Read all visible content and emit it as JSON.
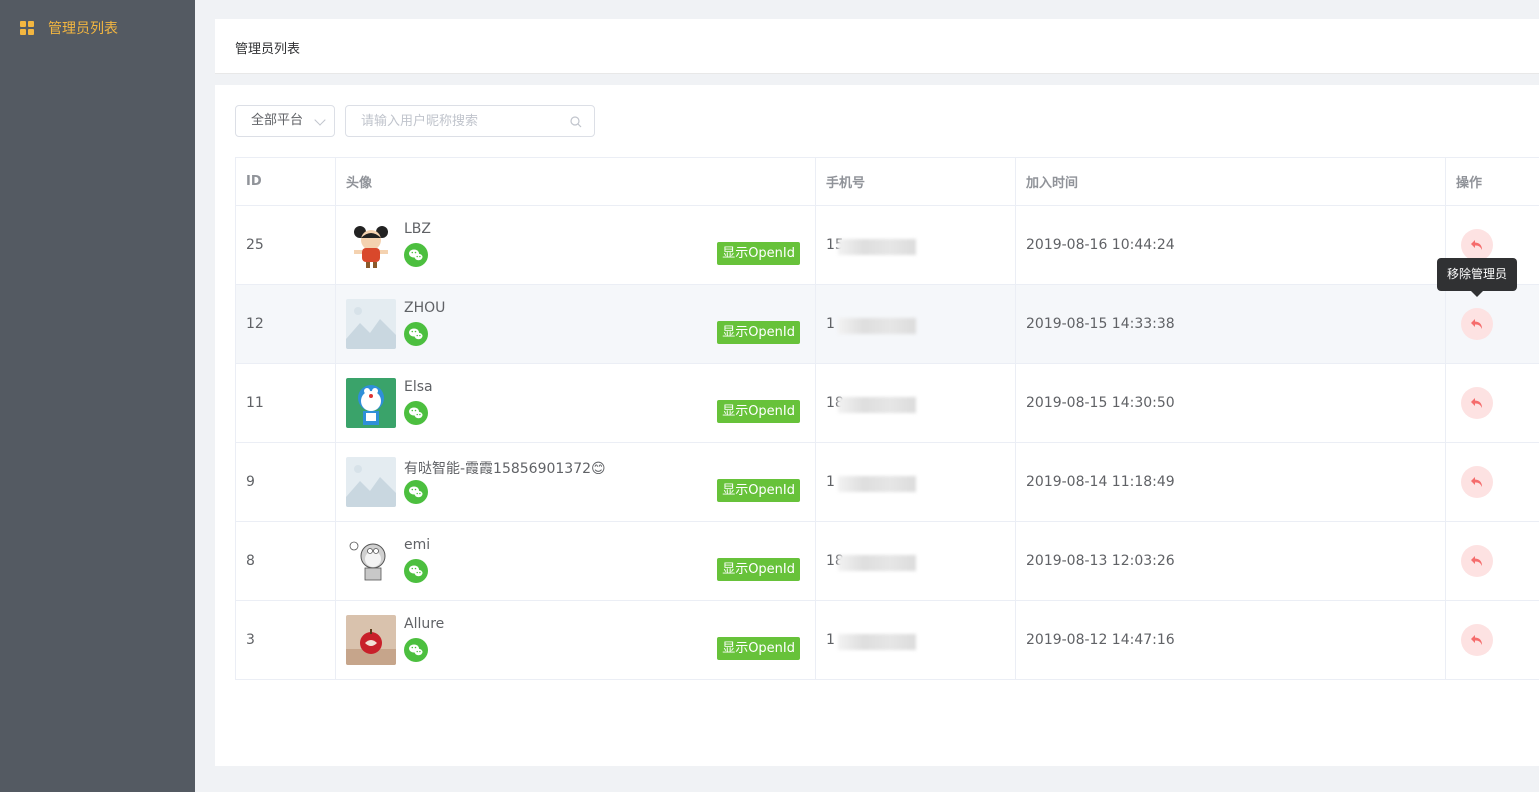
{
  "sidebar": {
    "item_label": "管理员列表",
    "icon": "grid-icon",
    "accent": "#f3b640"
  },
  "header": {
    "title": "管理员列表"
  },
  "filters": {
    "platform_value": "全部平台",
    "search_placeholder": "请输入用户昵称搜索"
  },
  "table": {
    "columns": [
      "ID",
      "头像",
      "手机号",
      "加入时间",
      "操作"
    ],
    "rows": [
      {
        "id": "25",
        "name": "LBZ",
        "phone_prefix": "15",
        "joined": "2019-08-16 10:44:24",
        "openid_label": "显示OpenId",
        "avatar": "cartoon-girl"
      },
      {
        "id": "12",
        "name": "ZHOU",
        "phone_prefix": "1",
        "joined": "2019-08-15 14:33:38",
        "openid_label": "显示OpenId",
        "avatar": "placeholder"
      },
      {
        "id": "11",
        "name": "Elsa",
        "phone_prefix": "18",
        "joined": "2019-08-15 14:30:50",
        "openid_label": "显示OpenId",
        "avatar": "doraemon"
      },
      {
        "id": "9",
        "name": "有哒智能-霞霞15856901372😊",
        "phone_prefix": "1",
        "joined": "2019-08-14 11:18:49",
        "openid_label": "显示OpenId",
        "avatar": "placeholder"
      },
      {
        "id": "8",
        "name": "emi",
        "phone_prefix": "18",
        "joined": "2019-08-13 12:03:26",
        "openid_label": "显示OpenId",
        "avatar": "sketch-robot"
      },
      {
        "id": "3",
        "name": "Allure",
        "phone_prefix": "1",
        "joined": "2019-08-12 14:47:16",
        "openid_label": "显示OpenId",
        "avatar": "apple"
      }
    ]
  },
  "tooltip": {
    "text": "移除管理员"
  },
  "colors": {
    "sidebar_bg": "#545a62",
    "openid_bg": "#67c23a",
    "wechat": "#4cbf3f",
    "remove_icon": "#f56c6c"
  }
}
